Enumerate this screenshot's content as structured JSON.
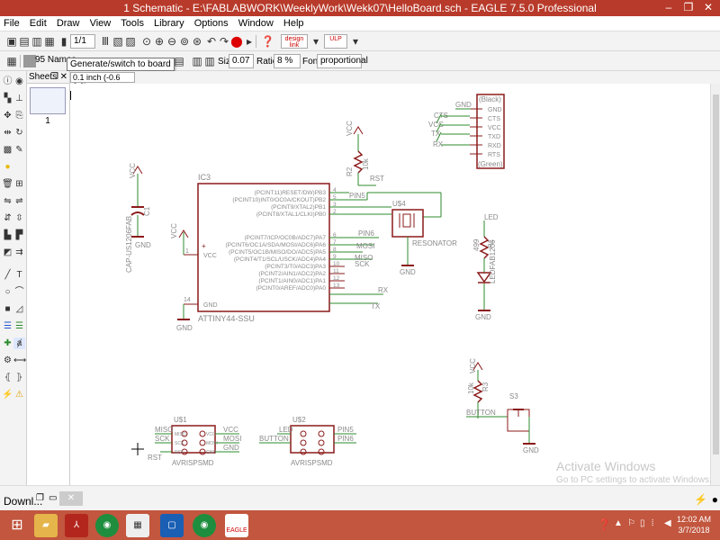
{
  "window": {
    "title": "1 Schematic - E:\\FABLABWORK\\WeeklyWork\\Wekk07\\HelloBoard.sch - EAGLE 7.5.0 Professional",
    "minimize": "–",
    "maximize": "❐",
    "close": "✕"
  },
  "menu": [
    "File",
    "Edit",
    "Draw",
    "View",
    "Tools",
    "Library",
    "Options",
    "Window",
    "Help"
  ],
  "toolbar": {
    "sheet_combo": "1/1",
    "tooltip": "Generate/switch to board",
    "names_label": "95 Names",
    "size_label": "Size:",
    "size_value": "0.07",
    "ratio_label": "Ratio:",
    "ratio_value": "8 %",
    "font_label": "Font:",
    "font_value": "proportional",
    "design_link": "design link",
    "ulp_label": "ULP"
  },
  "command": {
    "coordinate": "0.1 inch (-0.6 3.2)"
  },
  "sheets": {
    "header": "Sheets",
    "number": "1"
  },
  "schematic": {
    "ic3": {
      "name": "IC3",
      "value": "ATTINY44-SSU",
      "pins_right": [
        {
          "num": "4",
          "label": "(PCINT11)RESET/DW)PB3"
        },
        {
          "num": "5",
          "label": "(PCINT10)INT0/OC0A/CKOUT)PB2"
        },
        {
          "num": "3",
          "label": "(PCINT9/XTAL2)PB1"
        },
        {
          "num": "2",
          "label": "(PCINT8/XTAL1/CLKI)PB0"
        },
        {
          "num": "6",
          "label": "(PCINT7/ICP/OC0B/ADC7)PA7"
        },
        {
          "num": "7",
          "label": "(PCINT6/OC1A/SDA/MOSI/ADC6)PA6"
        },
        {
          "num": "8",
          "label": "(PCINT5/OC1B/MISO/DO/ADC5)PA5"
        },
        {
          "num": "9",
          "label": "(PCINT4/T1/SCL/USCK/ADC4)PA4"
        },
        {
          "num": "10",
          "label": "(PCINT3/T0/ADC3)PA3"
        },
        {
          "num": "11",
          "label": "(PCINT2/AIN1/ADC2)PA2"
        },
        {
          "num": "12",
          "label": "(PCINT1/AIN0/ADC1)PA1"
        },
        {
          "num": "13",
          "label": "(PCINT0/AREF/ADC0)PA0"
        }
      ],
      "vcc_pin": "1",
      "vcc_label": "VCC",
      "gnd_pin": "14",
      "gnd_label": "GND"
    },
    "labels": {
      "vcc": "VCC",
      "gnd": "GND",
      "rst": "RST",
      "pin5": "PIN5",
      "pin6": "PIN6",
      "mosi": "MOSI",
      "miso": "MISO",
      "sck": "SCK",
      "rx": "RX",
      "tx": "TX",
      "cts": "CTS",
      "led": "LED",
      "button": "BUTTON",
      "plus": "+"
    },
    "cap": {
      "name": "C1",
      "value": "CAP-US1206FAB"
    },
    "resistor_r2": {
      "name": "R2",
      "value": "10k"
    },
    "resistor_r1": {
      "name": "R1",
      "value": "499"
    },
    "resistor_r3": {
      "name": "R3",
      "value": "10k"
    },
    "resonator": {
      "name": "U$4",
      "value": "RESONATOR"
    },
    "led": {
      "value": "LEDFAB1206"
    },
    "switch": {
      "name": "S3"
    },
    "ftdi": {
      "black": "(Black)",
      "green": "(Green)",
      "pins": [
        "GND",
        "CTS",
        "VCC",
        "TXD",
        "RXD",
        "RTS"
      ]
    },
    "isp1": {
      "name": "U$1",
      "value": "AVRISPSMD",
      "left": [
        "MISO",
        "SCK",
        "RST"
      ],
      "right": [
        "VCC",
        "MOSI",
        "GND"
      ],
      "pins_left": [
        "MISO",
        "SCK",
        "RST"
      ],
      "pins_right": [
        "VCC",
        "MOSI",
        "GND"
      ]
    },
    "isp2": {
      "name": "U$2",
      "value": "AVRISPSMD",
      "left": [
        "LED",
        "BUTTON",
        ""
      ],
      "right": [
        "PIN5",
        "PIN6",
        ""
      ]
    }
  },
  "watermark": {
    "line1": "Activate Windows",
    "line2": "Go to PC settings to activate Windows."
  },
  "status": {
    "download": "Downl..."
  },
  "taskbar": {
    "time": "12:02 AM",
    "date": "3/7/2018",
    "eagle_label": "EAGLE"
  },
  "colors": {
    "titlebar": "#b83a2a",
    "taskbar": "#c2563e",
    "wire": "#2e8b2e",
    "part": "#8b1a1a",
    "text": "#8a8a8a"
  }
}
